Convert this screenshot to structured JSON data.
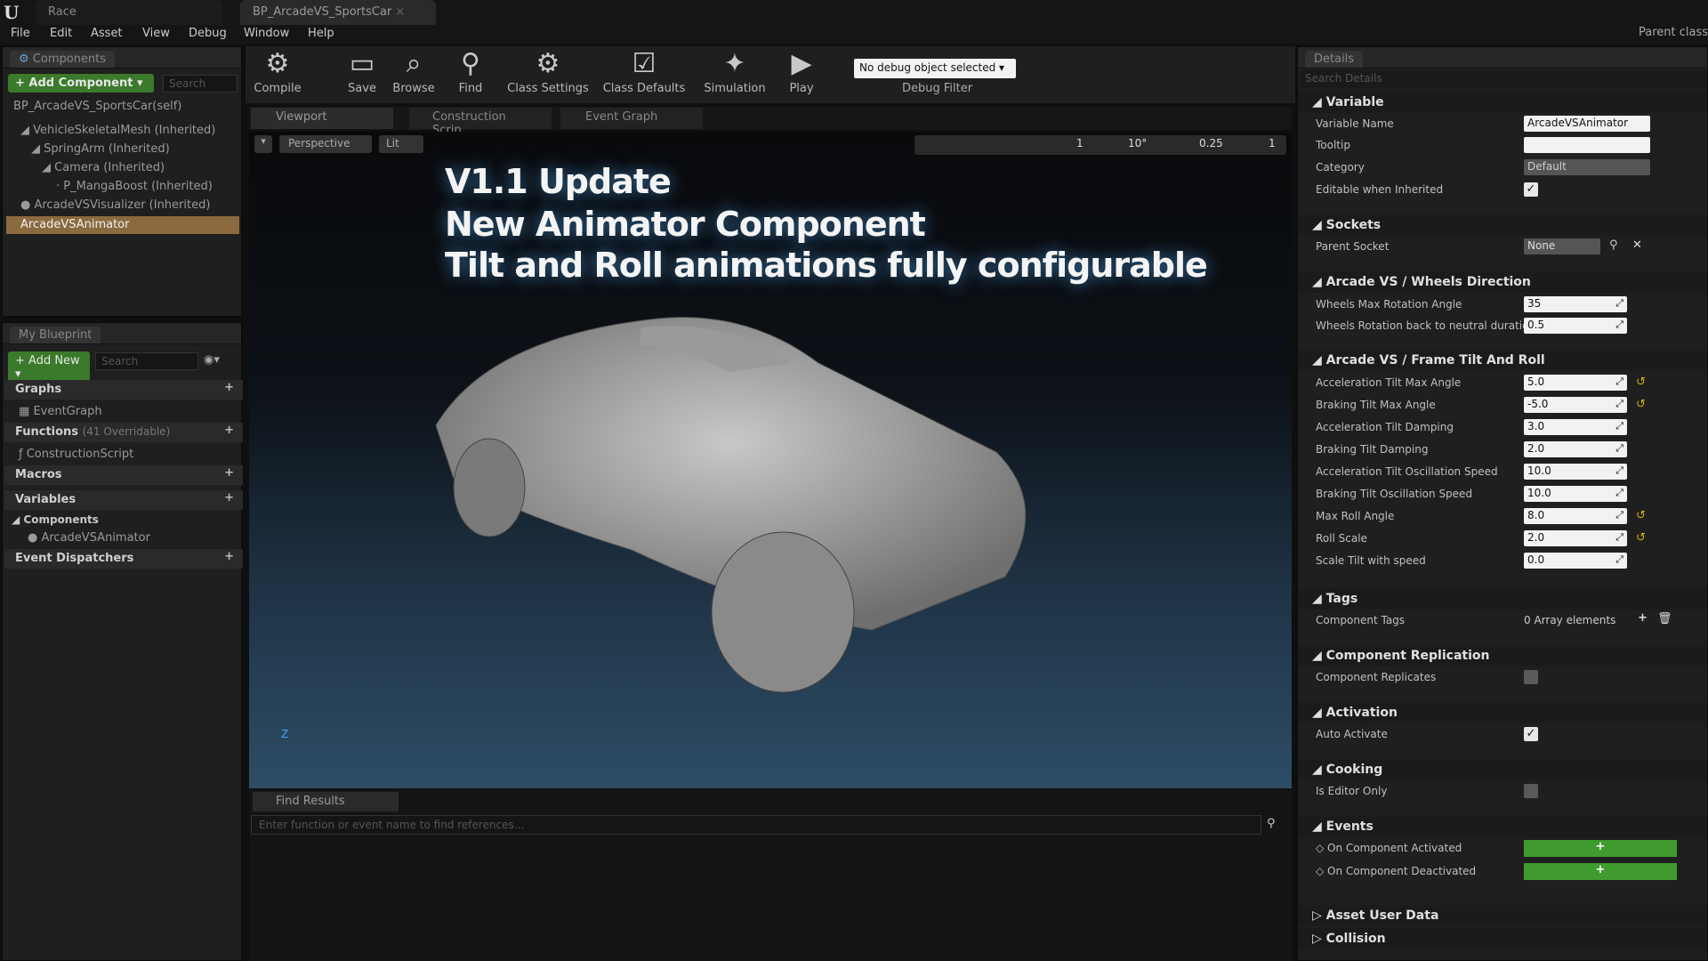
{
  "titlebar": {
    "tab1": "Race",
    "tab2": "BP_ArcadeVS_SportsCar",
    "parent_class": "Parent class"
  },
  "menu": [
    "File",
    "Edit",
    "Asset",
    "View",
    "Debug",
    "Window",
    "Help"
  ],
  "components": {
    "tab": "Components",
    "add_button": "+ Add Component ▾",
    "search_placeholder": "Search",
    "self": "BP_ArcadeVS_SportsCar(self)",
    "items": [
      "VehicleSkeletalMesh (Inherited)",
      "SpringArm (Inherited)",
      "Camera (Inherited)",
      "P_MangaBoost (Inherited)",
      "ArcadeVSVisualizer (Inherited)",
      "ArcadeVSAnimator"
    ]
  },
  "toolbar": {
    "items": [
      "Compile",
      "Save",
      "Browse",
      "Find",
      "Class Settings",
      "Class Defaults",
      "Simulation",
      "Play"
    ],
    "debug_select": "No debug object selected ▾",
    "debug_filter": "Debug Filter"
  },
  "editor_tabs": [
    "Viewport",
    "Construction Scrip",
    "Event Graph"
  ],
  "viewport": {
    "perspective": "Perspective",
    "lit": "Lit",
    "overlay": [
      "V1.1 Update",
      "New Animator Component",
      "Tilt and Roll animations fully configurable"
    ],
    "snap_values": [
      "1",
      "10°",
      "0.25",
      "1"
    ],
    "axis": "Z"
  },
  "myblueprint": {
    "tab": "My Blueprint",
    "add_button": "+ Add New ▾",
    "search_placeholder": "Search",
    "graphs": "Graphs",
    "eventgraph": "EventGraph",
    "functions": "Functions",
    "functions_count": "(41 Overridable)",
    "construction": "ConstructionScript",
    "macros": "Macros",
    "variables": "Variables",
    "components": "Components",
    "animator": "ArcadeVSAnimator",
    "dispatchers": "Event Dispatchers"
  },
  "findresults": {
    "tab": "Find Results",
    "placeholder": "Enter function or event name to find references..."
  },
  "details": {
    "tab": "Details",
    "search": "Search Details",
    "variable": {
      "title": "Variable",
      "name_label": "Variable Name",
      "name_value": "ArcadeVSAnimator",
      "tooltip_label": "Tooltip",
      "category_label": "Category",
      "category_value": "Default",
      "editable_label": "Editable when Inherited"
    },
    "sockets": {
      "title": "Sockets",
      "label": "Parent Socket",
      "value": "None"
    },
    "wheels": {
      "title": "Arcade VS / Wheels Direction",
      "rows": [
        {
          "label": "Wheels Max Rotation Angle",
          "value": "35"
        },
        {
          "label": "Wheels Rotation back to neutral duration",
          "value": "0.5"
        }
      ]
    },
    "tilt": {
      "title": "Arcade VS / Frame Tilt And Roll",
      "rows": [
        {
          "label": "Acceleration Tilt Max Angle",
          "value": "5.0"
        },
        {
          "label": "Braking Tilt Max Angle",
          "value": "-5.0"
        },
        {
          "label": "Acceleration Tilt Damping",
          "value": "3.0"
        },
        {
          "label": "Braking Tilt Damping",
          "value": "2.0"
        },
        {
          "label": "Acceleration Tilt Oscillation Speed",
          "value": "10.0"
        },
        {
          "label": "Braking Tilt Oscillation Speed",
          "value": "10.0"
        },
        {
          "label": "Max Roll Angle",
          "value": "8.0"
        },
        {
          "label": "Roll Scale",
          "value": "2.0"
        },
        {
          "label": "Scale Tilt with speed",
          "value": "0.0"
        }
      ]
    },
    "tags": {
      "title": "Tags",
      "label": "Component Tags",
      "value": "0 Array elements"
    },
    "replication": {
      "title": "Component Replication",
      "label": "Component Replicates"
    },
    "activation": {
      "title": "Activation",
      "label": "Auto Activate"
    },
    "cooking": {
      "title": "Cooking",
      "label": "Is Editor Only"
    },
    "events": {
      "title": "Events",
      "activated": "On Component Activated",
      "deactivated": "On Component Deactivated"
    },
    "asset_user_data": "Asset User Data",
    "collision": "Collision"
  }
}
